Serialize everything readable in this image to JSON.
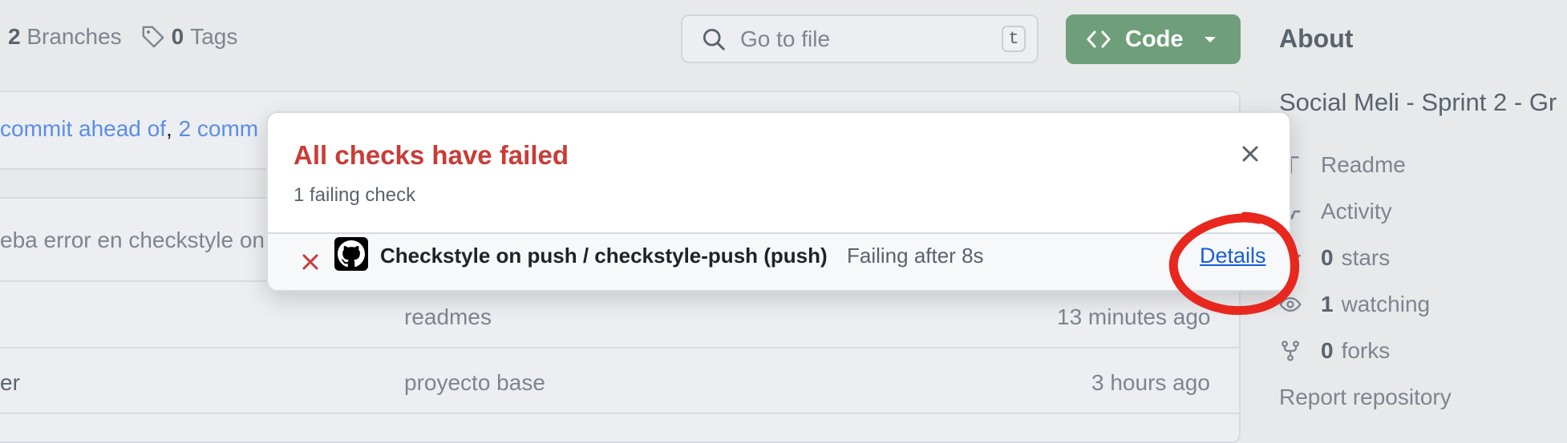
{
  "repo_bar": {
    "branches_count": "2",
    "branches_label": "Branches",
    "tags_count": "0",
    "tags_label": "Tags"
  },
  "search": {
    "placeholder": "Go to file",
    "shortcut": "t"
  },
  "code_button": {
    "label": "Code"
  },
  "branch_status": {
    "ahead_text": "commit ahead of",
    "separator": ",",
    "behind_text": "2 comm"
  },
  "files": {
    "latest_commit_message": "eba error en checkstyle on",
    "rows": [
      {
        "name": "",
        "message": "readmes",
        "time": "13 minutes ago"
      },
      {
        "name": "er",
        "message": "proyecto base",
        "time": "3 hours ago"
      }
    ]
  },
  "about": {
    "title": "About",
    "description": "Social Meli - Sprint 2 - Gr",
    "items": [
      {
        "icon": "book-icon",
        "count": "",
        "label": "Readme"
      },
      {
        "icon": "pulse-icon",
        "count": "",
        "label": "Activity"
      },
      {
        "icon": "star-icon",
        "count": "0",
        "label": "stars"
      },
      {
        "icon": "eye-icon",
        "count": "1",
        "label": "watching"
      },
      {
        "icon": "fork-icon",
        "count": "0",
        "label": "forks"
      }
    ],
    "report": "Report repository"
  },
  "checks_popover": {
    "title": "All checks have failed",
    "subtitle": "1 failing check",
    "check": {
      "name": "Checkstyle on push / checkstyle-push (push)",
      "status": "Failing after 8s",
      "details_label": "Details"
    }
  },
  "colors": {
    "failure": "#c93c37",
    "code_button": "#6f9f7a",
    "link": "#1a5cd7",
    "annotation": "#e8271e"
  }
}
